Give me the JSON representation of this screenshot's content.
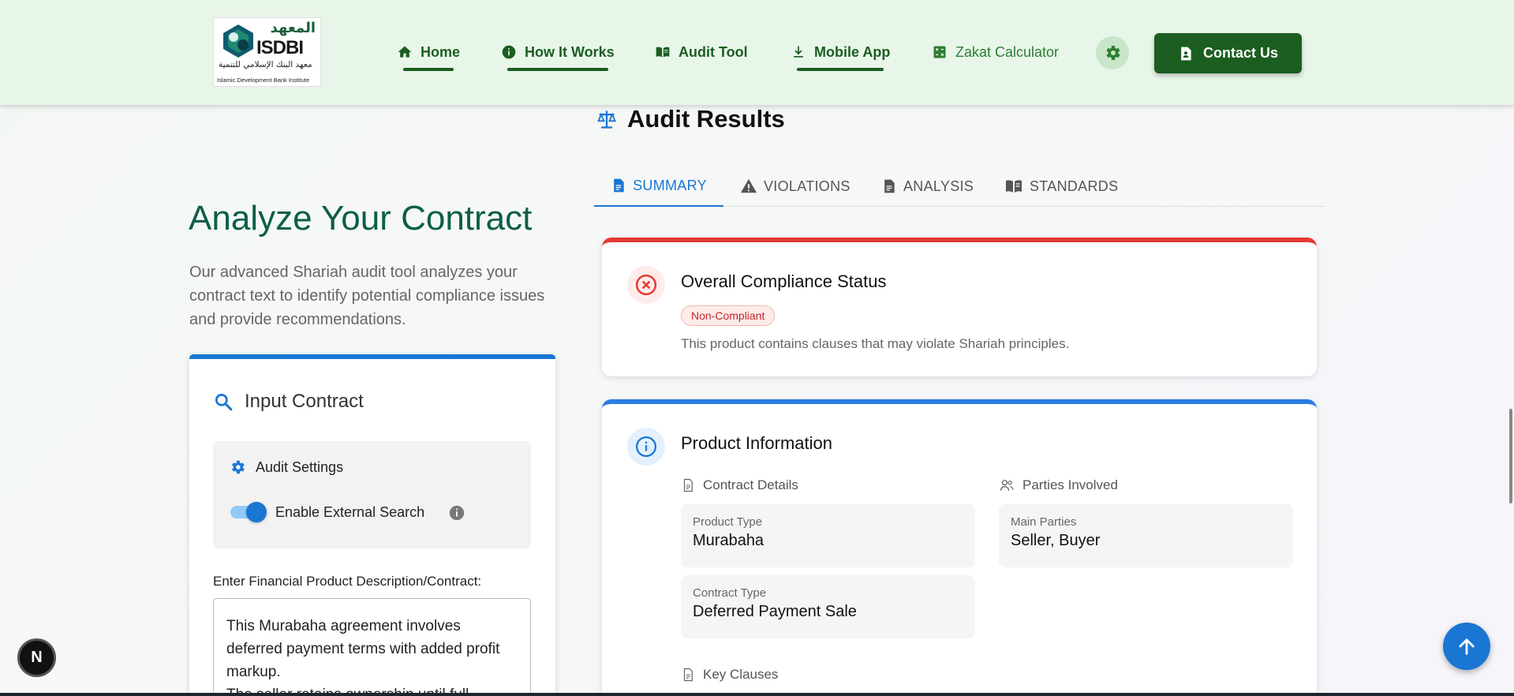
{
  "header": {
    "logo": {
      "arabic_title": "المعهد",
      "acronym": "ISDBI",
      "arabic_name": "معهد البنك الإسلامي للتنمية",
      "english_name": "Islamic Development Bank Institute"
    },
    "nav": [
      {
        "label": "Home",
        "icon": "home-icon"
      },
      {
        "label": "How It Works",
        "icon": "info-icon"
      },
      {
        "label": "Audit Tool",
        "icon": "book-icon"
      },
      {
        "label": "Mobile App",
        "icon": "download-icon"
      },
      {
        "label": "Zakat Calculator",
        "icon": "calculator-icon"
      }
    ],
    "settings_icon": "gear-icon",
    "contact_label": "Contact Us"
  },
  "left": {
    "title": "Analyze Your Contract",
    "description": "Our advanced Shariah audit tool analyzes your contract text to identify potential compliance issues and provide recommendations.",
    "input_card": {
      "title": "Input Contract",
      "settings_title": "Audit Settings",
      "toggle_label": "Enable External Search",
      "toggle_on": true,
      "field_label": "Enter Financial Product Description/Contract:",
      "contract_text": "This Murabaha agreement involves deferred payment terms with added profit markup.\nThe seller retains ownership until full"
    }
  },
  "results": {
    "title": "Audit Results",
    "tabs": [
      "SUMMARY",
      "VIOLATIONS",
      "ANALYSIS",
      "STANDARDS"
    ],
    "active_tab": "SUMMARY",
    "status_card": {
      "title": "Overall Compliance Status",
      "badge": "Non-Compliant",
      "description": "This product contains clauses that may violate Shariah principles."
    },
    "product_card": {
      "title": "Product Information",
      "contract_details_label": "Contract Details",
      "parties_label": "Parties Involved",
      "product_type_label": "Product Type",
      "product_type": "Murabaha",
      "main_parties_label": "Main Parties",
      "main_parties": "Seller, Buyer",
      "contract_type_label": "Contract Type",
      "contract_type": "Deferred Payment Sale",
      "key_clauses_label": "Key Clauses"
    }
  },
  "floating": {
    "n_badge": "N"
  },
  "colors": {
    "header_bg": "#e8f5e9",
    "brand_green": "#1b5e20",
    "accent_blue": "#1976d2",
    "error_red": "#e53935"
  }
}
